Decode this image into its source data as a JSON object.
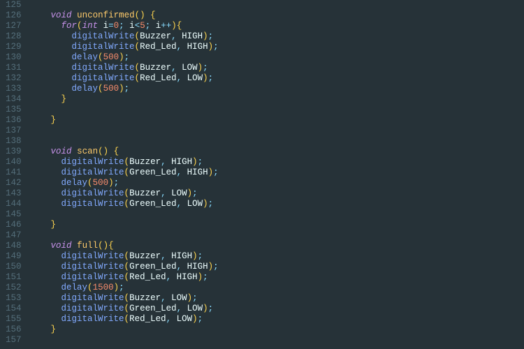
{
  "editor": {
    "startLine": 125,
    "lines": [
      {
        "n": 125,
        "tokens": []
      },
      {
        "n": 126,
        "tokens": [
          {
            "t": "    ",
            "c": "text"
          },
          {
            "t": "void",
            "c": "type"
          },
          {
            "t": " ",
            "c": "text"
          },
          {
            "t": "unconfirmed",
            "c": "funcname"
          },
          {
            "t": "()",
            "c": "paren"
          },
          {
            "t": " ",
            "c": "text"
          },
          {
            "t": "{",
            "c": "brace"
          }
        ]
      },
      {
        "n": 127,
        "tokens": [
          {
            "t": "      ",
            "c": "text"
          },
          {
            "t": "for",
            "c": "keyword"
          },
          {
            "t": "(",
            "c": "paren"
          },
          {
            "t": "int",
            "c": "type"
          },
          {
            "t": " ",
            "c": "text"
          },
          {
            "t": "i",
            "c": "ident"
          },
          {
            "t": "=",
            "c": "op"
          },
          {
            "t": "0",
            "c": "number"
          },
          {
            "t": ";",
            "c": "semi"
          },
          {
            "t": " ",
            "c": "text"
          },
          {
            "t": "i",
            "c": "ident"
          },
          {
            "t": "<",
            "c": "op"
          },
          {
            "t": "5",
            "c": "number"
          },
          {
            "t": ";",
            "c": "semi"
          },
          {
            "t": " ",
            "c": "text"
          },
          {
            "t": "i",
            "c": "ident"
          },
          {
            "t": "++",
            "c": "op"
          },
          {
            "t": ")",
            "c": "paren"
          },
          {
            "t": "{",
            "c": "brace"
          }
        ]
      },
      {
        "n": 128,
        "tokens": [
          {
            "t": "        ",
            "c": "text"
          },
          {
            "t": "digitalWrite",
            "c": "func"
          },
          {
            "t": "(",
            "c": "paren"
          },
          {
            "t": "Buzzer",
            "c": "ident"
          },
          {
            "t": ",",
            "c": "comma"
          },
          {
            "t": " ",
            "c": "text"
          },
          {
            "t": "HIGH",
            "c": "ident"
          },
          {
            "t": ")",
            "c": "paren"
          },
          {
            "t": ";",
            "c": "semi"
          }
        ]
      },
      {
        "n": 129,
        "tokens": [
          {
            "t": "        ",
            "c": "text"
          },
          {
            "t": "digitalWrite",
            "c": "func"
          },
          {
            "t": "(",
            "c": "paren"
          },
          {
            "t": "Red_Led",
            "c": "ident"
          },
          {
            "t": ",",
            "c": "comma"
          },
          {
            "t": " ",
            "c": "text"
          },
          {
            "t": "HIGH",
            "c": "ident"
          },
          {
            "t": ")",
            "c": "paren"
          },
          {
            "t": ";",
            "c": "semi"
          }
        ]
      },
      {
        "n": 130,
        "tokens": [
          {
            "t": "        ",
            "c": "text"
          },
          {
            "t": "delay",
            "c": "func"
          },
          {
            "t": "(",
            "c": "paren"
          },
          {
            "t": "500",
            "c": "number"
          },
          {
            "t": ")",
            "c": "paren"
          },
          {
            "t": ";",
            "c": "semi"
          }
        ]
      },
      {
        "n": 131,
        "tokens": [
          {
            "t": "        ",
            "c": "text"
          },
          {
            "t": "digitalWrite",
            "c": "func"
          },
          {
            "t": "(",
            "c": "paren"
          },
          {
            "t": "Buzzer",
            "c": "ident"
          },
          {
            "t": ",",
            "c": "comma"
          },
          {
            "t": " ",
            "c": "text"
          },
          {
            "t": "LOW",
            "c": "ident"
          },
          {
            "t": ")",
            "c": "paren"
          },
          {
            "t": ";",
            "c": "semi"
          }
        ]
      },
      {
        "n": 132,
        "tokens": [
          {
            "t": "        ",
            "c": "text"
          },
          {
            "t": "digitalWrite",
            "c": "func"
          },
          {
            "t": "(",
            "c": "paren"
          },
          {
            "t": "Red_Led",
            "c": "ident"
          },
          {
            "t": ",",
            "c": "comma"
          },
          {
            "t": " ",
            "c": "text"
          },
          {
            "t": "LOW",
            "c": "ident"
          },
          {
            "t": ")",
            "c": "paren"
          },
          {
            "t": ";",
            "c": "semi"
          }
        ]
      },
      {
        "n": 133,
        "tokens": [
          {
            "t": "        ",
            "c": "text"
          },
          {
            "t": "delay",
            "c": "func"
          },
          {
            "t": "(",
            "c": "paren"
          },
          {
            "t": "500",
            "c": "number"
          },
          {
            "t": ")",
            "c": "paren"
          },
          {
            "t": ";",
            "c": "semi"
          }
        ]
      },
      {
        "n": 134,
        "tokens": [
          {
            "t": "      ",
            "c": "text"
          },
          {
            "t": "}",
            "c": "brace"
          }
        ]
      },
      {
        "n": 135,
        "tokens": []
      },
      {
        "n": 136,
        "tokens": [
          {
            "t": "    ",
            "c": "text"
          },
          {
            "t": "}",
            "c": "brace"
          }
        ]
      },
      {
        "n": 137,
        "tokens": []
      },
      {
        "n": 138,
        "tokens": []
      },
      {
        "n": 139,
        "tokens": [
          {
            "t": "    ",
            "c": "text"
          },
          {
            "t": "void",
            "c": "type"
          },
          {
            "t": " ",
            "c": "text"
          },
          {
            "t": "scan",
            "c": "funcname"
          },
          {
            "t": "()",
            "c": "paren"
          },
          {
            "t": " ",
            "c": "text"
          },
          {
            "t": "{",
            "c": "brace"
          }
        ]
      },
      {
        "n": 140,
        "tokens": [
          {
            "t": "      ",
            "c": "text"
          },
          {
            "t": "digitalWrite",
            "c": "func"
          },
          {
            "t": "(",
            "c": "paren"
          },
          {
            "t": "Buzzer",
            "c": "ident"
          },
          {
            "t": ",",
            "c": "comma"
          },
          {
            "t": " ",
            "c": "text"
          },
          {
            "t": "HIGH",
            "c": "ident"
          },
          {
            "t": ")",
            "c": "paren"
          },
          {
            "t": ";",
            "c": "semi"
          }
        ]
      },
      {
        "n": 141,
        "tokens": [
          {
            "t": "      ",
            "c": "text"
          },
          {
            "t": "digitalWrite",
            "c": "func"
          },
          {
            "t": "(",
            "c": "paren"
          },
          {
            "t": "Green_Led",
            "c": "ident"
          },
          {
            "t": ",",
            "c": "comma"
          },
          {
            "t": " ",
            "c": "text"
          },
          {
            "t": "HIGH",
            "c": "ident"
          },
          {
            "t": ")",
            "c": "paren"
          },
          {
            "t": ";",
            "c": "semi"
          }
        ]
      },
      {
        "n": 142,
        "tokens": [
          {
            "t": "      ",
            "c": "text"
          },
          {
            "t": "delay",
            "c": "func"
          },
          {
            "t": "(",
            "c": "paren"
          },
          {
            "t": "500",
            "c": "number"
          },
          {
            "t": ")",
            "c": "paren"
          },
          {
            "t": ";",
            "c": "semi"
          }
        ]
      },
      {
        "n": 143,
        "tokens": [
          {
            "t": "      ",
            "c": "text"
          },
          {
            "t": "digitalWrite",
            "c": "func"
          },
          {
            "t": "(",
            "c": "paren"
          },
          {
            "t": "Buzzer",
            "c": "ident"
          },
          {
            "t": ",",
            "c": "comma"
          },
          {
            "t": " ",
            "c": "text"
          },
          {
            "t": "LOW",
            "c": "ident"
          },
          {
            "t": ")",
            "c": "paren"
          },
          {
            "t": ";",
            "c": "semi"
          }
        ]
      },
      {
        "n": 144,
        "tokens": [
          {
            "t": "      ",
            "c": "text"
          },
          {
            "t": "digitalWrite",
            "c": "func"
          },
          {
            "t": "(",
            "c": "paren"
          },
          {
            "t": "Green_Led",
            "c": "ident"
          },
          {
            "t": ",",
            "c": "comma"
          },
          {
            "t": " ",
            "c": "text"
          },
          {
            "t": "LOW",
            "c": "ident"
          },
          {
            "t": ")",
            "c": "paren"
          },
          {
            "t": ";",
            "c": "semi"
          }
        ]
      },
      {
        "n": 145,
        "tokens": []
      },
      {
        "n": 146,
        "tokens": [
          {
            "t": "    ",
            "c": "text"
          },
          {
            "t": "}",
            "c": "brace"
          }
        ]
      },
      {
        "n": 147,
        "tokens": []
      },
      {
        "n": 148,
        "tokens": [
          {
            "t": "    ",
            "c": "text"
          },
          {
            "t": "void",
            "c": "type"
          },
          {
            "t": " ",
            "c": "text"
          },
          {
            "t": "full",
            "c": "funcname"
          },
          {
            "t": "()",
            "c": "paren"
          },
          {
            "t": "{",
            "c": "brace"
          }
        ]
      },
      {
        "n": 149,
        "tokens": [
          {
            "t": "      ",
            "c": "text"
          },
          {
            "t": "digitalWrite",
            "c": "func"
          },
          {
            "t": "(",
            "c": "paren"
          },
          {
            "t": "Buzzer",
            "c": "ident"
          },
          {
            "t": ",",
            "c": "comma"
          },
          {
            "t": " ",
            "c": "text"
          },
          {
            "t": "HIGH",
            "c": "ident"
          },
          {
            "t": ")",
            "c": "paren"
          },
          {
            "t": ";",
            "c": "semi"
          }
        ]
      },
      {
        "n": 150,
        "tokens": [
          {
            "t": "      ",
            "c": "text"
          },
          {
            "t": "digitalWrite",
            "c": "func"
          },
          {
            "t": "(",
            "c": "paren"
          },
          {
            "t": "Green_Led",
            "c": "ident"
          },
          {
            "t": ",",
            "c": "comma"
          },
          {
            "t": " ",
            "c": "text"
          },
          {
            "t": "HIGH",
            "c": "ident"
          },
          {
            "t": ")",
            "c": "paren"
          },
          {
            "t": ";",
            "c": "semi"
          }
        ]
      },
      {
        "n": 151,
        "tokens": [
          {
            "t": "      ",
            "c": "text"
          },
          {
            "t": "digitalWrite",
            "c": "func"
          },
          {
            "t": "(",
            "c": "paren"
          },
          {
            "t": "Red_Led",
            "c": "ident"
          },
          {
            "t": ",",
            "c": "comma"
          },
          {
            "t": " ",
            "c": "text"
          },
          {
            "t": "HIGH",
            "c": "ident"
          },
          {
            "t": ")",
            "c": "paren"
          },
          {
            "t": ";",
            "c": "semi"
          }
        ]
      },
      {
        "n": 152,
        "tokens": [
          {
            "t": "      ",
            "c": "text"
          },
          {
            "t": "delay",
            "c": "func"
          },
          {
            "t": "(",
            "c": "paren"
          },
          {
            "t": "1500",
            "c": "number"
          },
          {
            "t": ")",
            "c": "paren"
          },
          {
            "t": ";",
            "c": "semi"
          }
        ]
      },
      {
        "n": 153,
        "tokens": [
          {
            "t": "      ",
            "c": "text"
          },
          {
            "t": "digitalWrite",
            "c": "func"
          },
          {
            "t": "(",
            "c": "paren"
          },
          {
            "t": "Buzzer",
            "c": "ident"
          },
          {
            "t": ",",
            "c": "comma"
          },
          {
            "t": " ",
            "c": "text"
          },
          {
            "t": "LOW",
            "c": "ident"
          },
          {
            "t": ")",
            "c": "paren"
          },
          {
            "t": ";",
            "c": "semi"
          }
        ]
      },
      {
        "n": 154,
        "tokens": [
          {
            "t": "      ",
            "c": "text"
          },
          {
            "t": "digitalWrite",
            "c": "func"
          },
          {
            "t": "(",
            "c": "paren"
          },
          {
            "t": "Green_Led",
            "c": "ident"
          },
          {
            "t": ",",
            "c": "comma"
          },
          {
            "t": " ",
            "c": "text"
          },
          {
            "t": "LOW",
            "c": "ident"
          },
          {
            "t": ")",
            "c": "paren"
          },
          {
            "t": ";",
            "c": "semi"
          }
        ]
      },
      {
        "n": 155,
        "tokens": [
          {
            "t": "      ",
            "c": "text"
          },
          {
            "t": "digitalWrite",
            "c": "func"
          },
          {
            "t": "(",
            "c": "paren"
          },
          {
            "t": "Red_Led",
            "c": "ident"
          },
          {
            "t": ",",
            "c": "comma"
          },
          {
            "t": " ",
            "c": "text"
          },
          {
            "t": "LOW",
            "c": "ident"
          },
          {
            "t": ")",
            "c": "paren"
          },
          {
            "t": ";",
            "c": "semi"
          }
        ]
      },
      {
        "n": 156,
        "tokens": [
          {
            "t": "    ",
            "c": "text"
          },
          {
            "t": "}",
            "c": "brace"
          }
        ]
      },
      {
        "n": 157,
        "tokens": []
      }
    ]
  }
}
